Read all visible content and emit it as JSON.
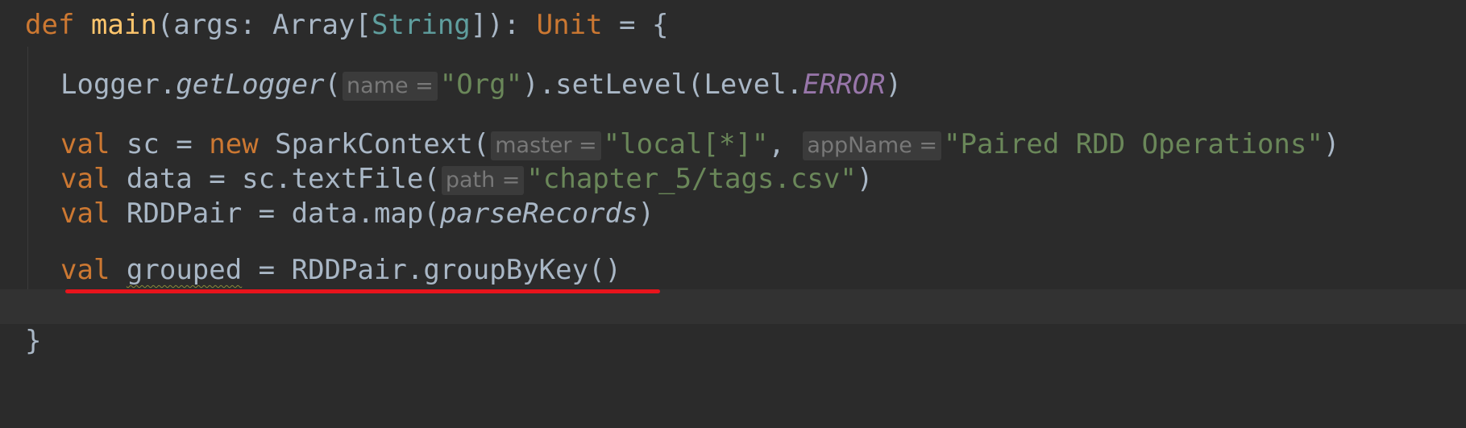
{
  "code": {
    "line1": {
      "kw_def": "def",
      "fn_name": "main",
      "open_args": "(args: ",
      "type_array": "Array",
      "bracket_open": "[",
      "type_string": "String",
      "close_sig": "]): ",
      "type_unit": "Unit",
      "eq_brace": " = {"
    },
    "line3": {
      "logger": "Logger.",
      "method": "getLogger",
      "paren_open": "(",
      "hint": "name =",
      "str": "\"Org\"",
      "rest": ").setLevel(Level.",
      "const": "ERROR",
      "paren_close": ")"
    },
    "line5": {
      "kw_val": "val",
      "decl": " sc = ",
      "kw_new": "new",
      "ctor": " SparkContext(",
      "hint_master": "master =",
      "str_master": "\"local[*]\"",
      "comma": ", ",
      "hint_app": "appName =",
      "str_app": "\"Paired RDD Operations\"",
      "paren_close": ")"
    },
    "line6": {
      "kw_val": "val",
      "decl": " data = sc.textFile(",
      "hint": "path =",
      "str": "\"chapter_5/tags.csv\"",
      "paren_close": ")"
    },
    "line7": {
      "kw_val": "val",
      "decl": " RDDPair = data.map(",
      "fn": "parseRecords",
      "paren_close": ")"
    },
    "line8": {
      "kw_val": "val",
      "space": " ",
      "var": "grouped",
      "rest": " = RDDPair.groupByKey()"
    },
    "line10": {
      "brace": "}"
    }
  },
  "colors": {
    "background": "#2b2b2b",
    "keyword": "#cc7832",
    "string": "#6a8759",
    "annotation": "#e8141c"
  }
}
